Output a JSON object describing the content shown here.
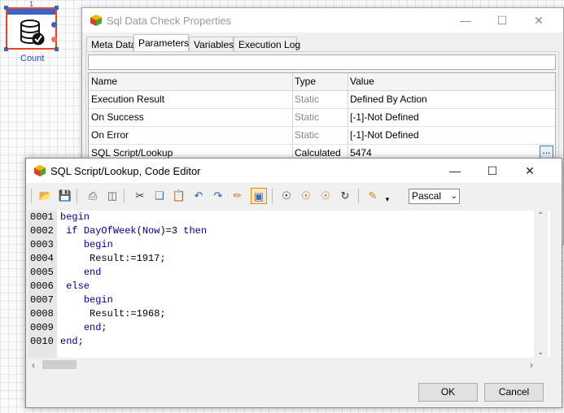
{
  "canvas": {
    "node_number": "1",
    "node_caption": "Count"
  },
  "properties_window": {
    "title": "Sql Data Check Properties",
    "controls": {
      "minimize": "—",
      "maximize": "☐",
      "close": "✕"
    },
    "tabs": [
      {
        "label": "Meta Data",
        "active": false
      },
      {
        "label": "Parameters",
        "active": true
      },
      {
        "label": "Variables",
        "active": false
      },
      {
        "label": "Execution Log",
        "active": false
      }
    ],
    "grid": {
      "columns": [
        "Name",
        "Type",
        "Value"
      ],
      "rows": [
        {
          "name": "Execution Result",
          "type": "Static",
          "value": "Defined By Action"
        },
        {
          "name": "On Success",
          "type": "Static",
          "value": "[-1]-Not Defined"
        },
        {
          "name": "On Error",
          "type": "Static",
          "value": "[-1]-Not Defined"
        },
        {
          "name": "SQL Script/Lookup",
          "type": "Calculated",
          "value": "5474",
          "ellipsis": "..."
        }
      ]
    }
  },
  "editor_window": {
    "title": "SQL Script/Lookup, Code Editor",
    "controls": {
      "minimize": "—",
      "maximize": "☐",
      "close": "✕"
    },
    "toolbar": {
      "language": "Pascal",
      "icons": [
        "open-folder-icon",
        "save-icon",
        "print-icon",
        "print-preview-icon",
        "cut-icon",
        "copy-icon",
        "paste-icon",
        "undo-icon",
        "redo-icon",
        "clear-icon",
        "window-toggle-icon",
        "find-icon",
        "find-next-icon",
        "replace-icon",
        "goto-icon",
        "bookmark-icon"
      ]
    },
    "code_lines": [
      {
        "num": "0001",
        "parts": [
          [
            "kw",
            "begin"
          ]
        ]
      },
      {
        "num": "0002",
        "parts": [
          [
            "t",
            " "
          ],
          [
            "kw",
            "if"
          ],
          [
            "t",
            " "
          ],
          [
            "fn",
            "DayOfWeek"
          ],
          [
            "t",
            "("
          ],
          [
            "fn",
            "Now"
          ],
          [
            "t",
            ")=3 "
          ],
          [
            "kw",
            "then"
          ]
        ]
      },
      {
        "num": "0003",
        "parts": [
          [
            "t",
            "    "
          ],
          [
            "kw",
            "begin"
          ]
        ]
      },
      {
        "num": "0004",
        "parts": [
          [
            "t",
            "     Result:=1917;"
          ]
        ]
      },
      {
        "num": "0005",
        "parts": [
          [
            "t",
            "    "
          ],
          [
            "kw",
            "end"
          ]
        ]
      },
      {
        "num": "0006",
        "parts": [
          [
            "t",
            " "
          ],
          [
            "kw",
            "else"
          ]
        ]
      },
      {
        "num": "0007",
        "parts": [
          [
            "t",
            "    "
          ],
          [
            "kw",
            "begin"
          ]
        ]
      },
      {
        "num": "0008",
        "parts": [
          [
            "t",
            "     Result:=1968;"
          ]
        ]
      },
      {
        "num": "0009",
        "parts": [
          [
            "t",
            "    "
          ],
          [
            "kw",
            "end"
          ],
          [
            "t",
            ";"
          ]
        ]
      },
      {
        "num": "0010",
        "parts": [
          [
            "kw",
            "end"
          ],
          [
            "t",
            ";"
          ]
        ]
      }
    ],
    "buttons": {
      "ok": "OK",
      "cancel": "Cancel"
    }
  }
}
